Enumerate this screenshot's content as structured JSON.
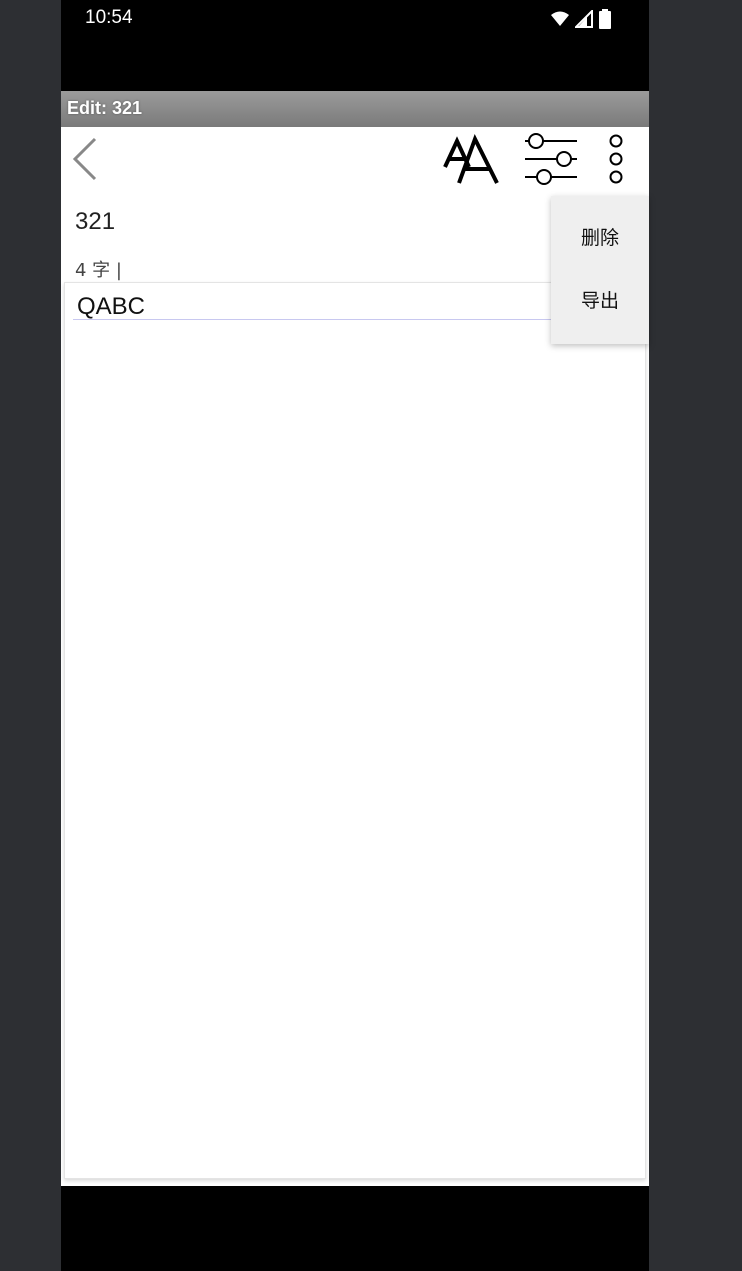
{
  "status_bar": {
    "time": "10:54",
    "icons": [
      "wifi-icon",
      "signal-icon",
      "battery-icon"
    ]
  },
  "window": {
    "title": "Edit: 321"
  },
  "toolbar": {
    "back_icon": "back-arrow-icon",
    "font_icon": "font-size-icon",
    "settings_icon": "sliders-icon",
    "more_icon": "more-vertical-icon"
  },
  "note": {
    "title": "321",
    "char_count": "4 字 |",
    "content": "QABC"
  },
  "menu": {
    "items": [
      {
        "label": "删除"
      },
      {
        "label": "导出"
      }
    ]
  },
  "colors": {
    "background": "#2d2f33",
    "title_bar": "#8a8a8a",
    "menu_bg": "#efefef"
  }
}
